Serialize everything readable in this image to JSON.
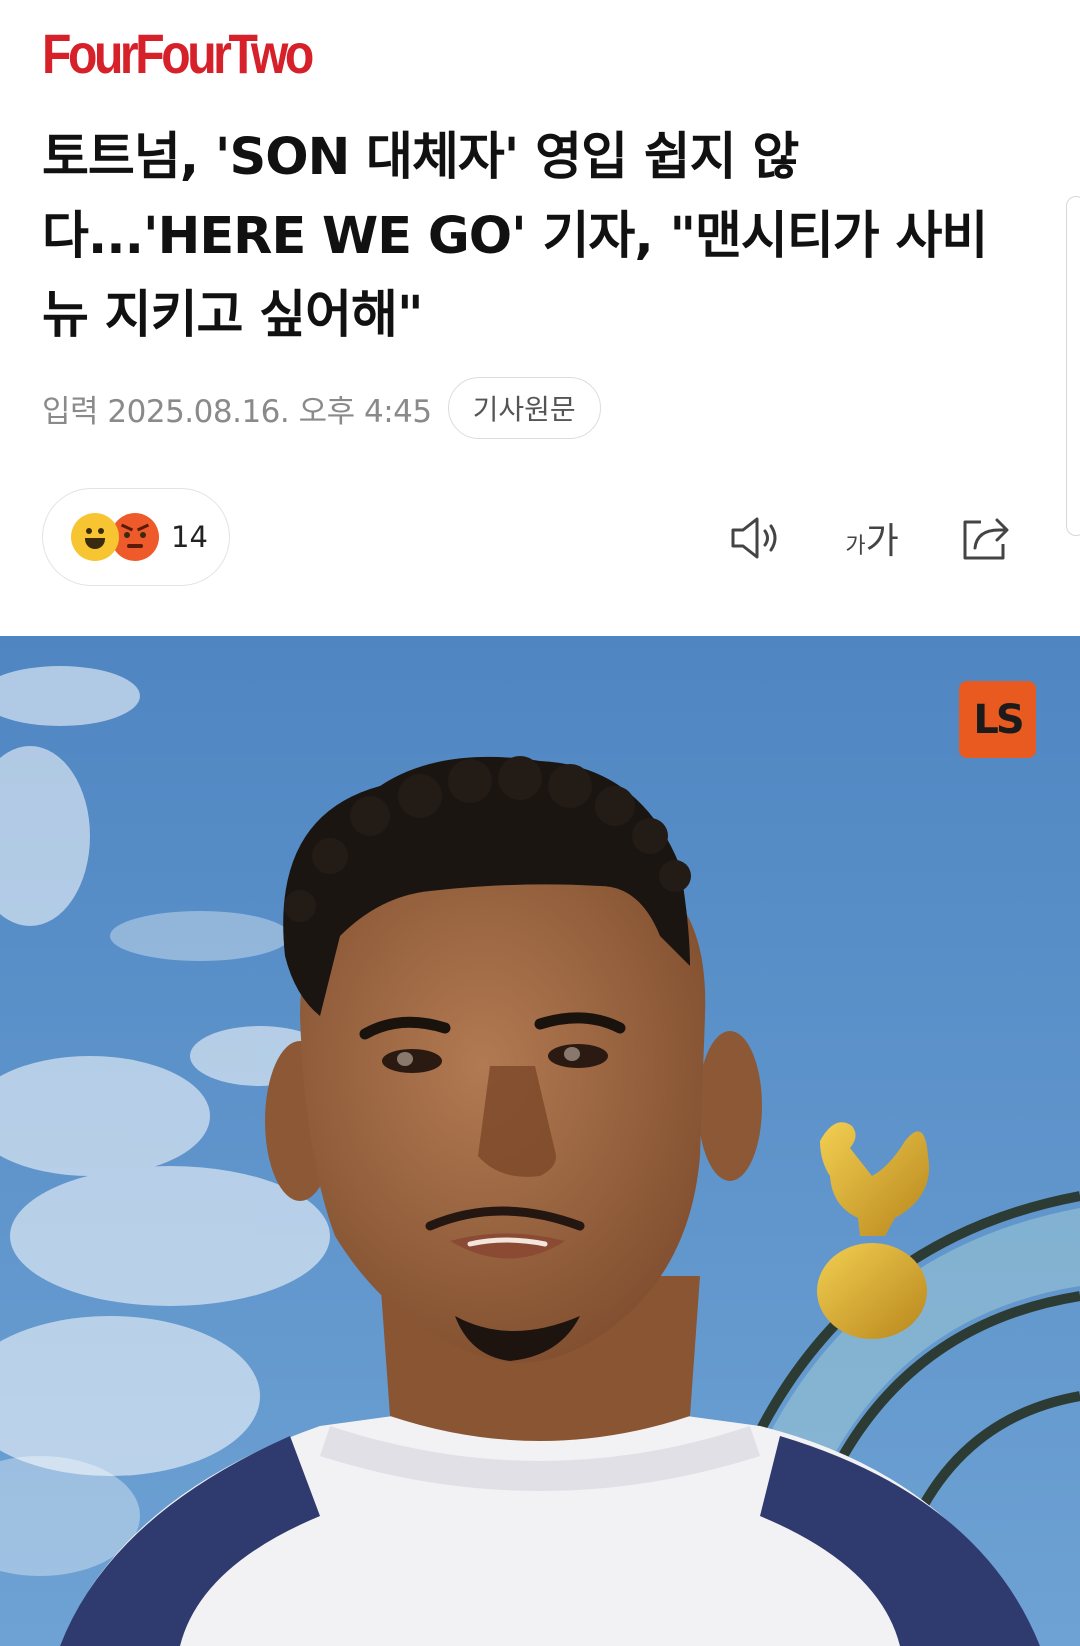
{
  "header": {
    "logo_text": "FourFourTwo"
  },
  "article": {
    "title": "토트넘, 'SON 대체자' 영입 쉽지 않다...'HERE WE GO' 기자, \"맨시티가 사비뉴 지키고 싶어해\"",
    "published": "입력 2025.08.16. 오후 4:45",
    "source_button_label": "기사원문"
  },
  "reactions": {
    "emoji_icons": [
      "happy-face-icon",
      "angry-face-icon"
    ],
    "count": "14"
  },
  "toolbar": {
    "icons": [
      "speaker-icon",
      "font-size-icon",
      "share-icon"
    ],
    "font_small": "가",
    "font_big": "가"
  },
  "photo": {
    "badge_text": "LS"
  },
  "colors": {
    "brand_red": "#d6202a",
    "badge_orange": "#e85a1f",
    "meta_gray": "#8a8a8a",
    "sky_blue": "#5a90c8"
  }
}
